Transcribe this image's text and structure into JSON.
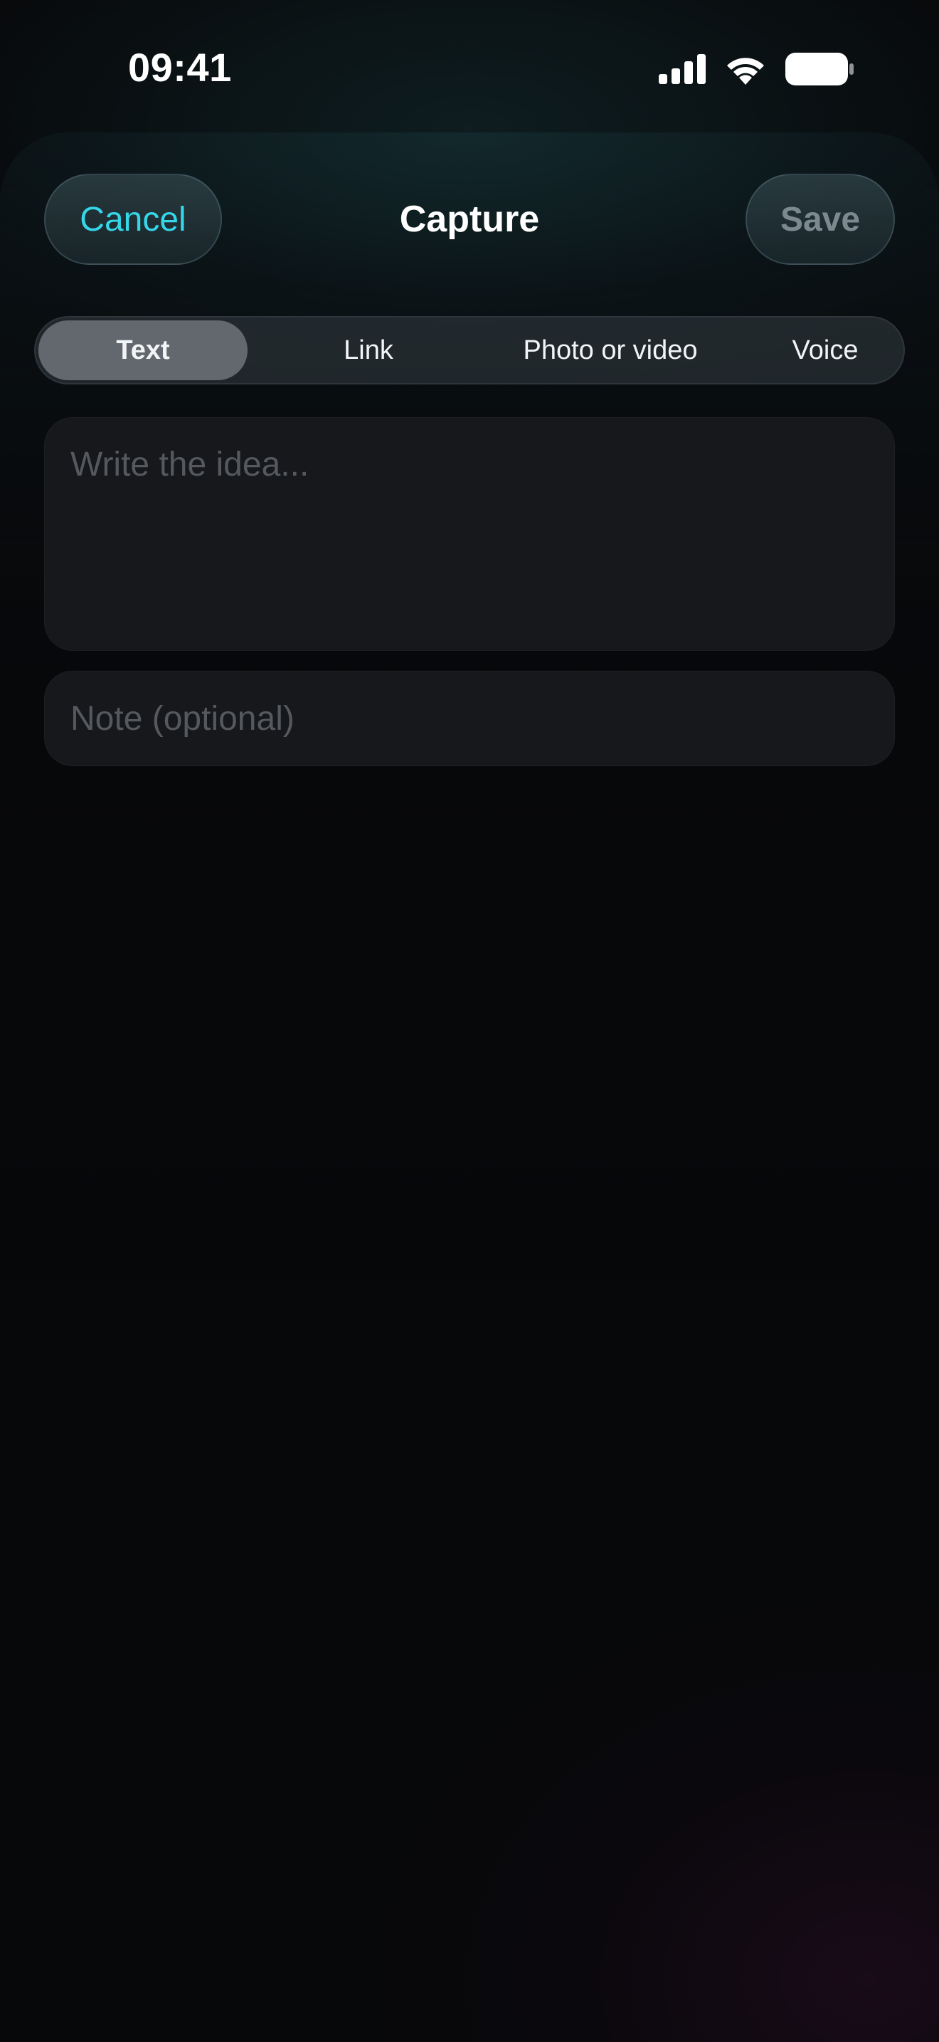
{
  "status_bar": {
    "time": "09:41",
    "icons": [
      "cellular-signal-icon",
      "wifi-icon",
      "battery-icon"
    ]
  },
  "nav": {
    "cancel_label": "Cancel",
    "title": "Capture",
    "save_label": "Save"
  },
  "segments": {
    "active_index": 0,
    "items": [
      {
        "label": "Text"
      },
      {
        "label": "Link"
      },
      {
        "label": "Photo or video"
      },
      {
        "label": "Voice"
      }
    ]
  },
  "fields": {
    "idea": {
      "value": "",
      "placeholder": "Write the idea..."
    },
    "note": {
      "value": "",
      "placeholder": "Note (optional)"
    }
  },
  "colors": {
    "accent": "#35d6e8",
    "background": "#07080a",
    "field_background": "#16181b",
    "segment_active": "#63686e",
    "save_disabled": "#7c8a90"
  }
}
